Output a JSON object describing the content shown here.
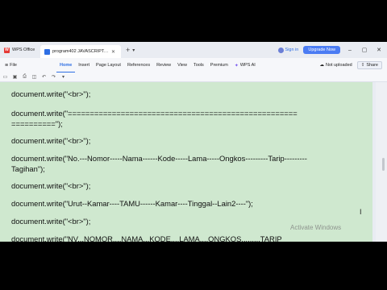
{
  "tabbar": {
    "wps_tab": "WPS Office",
    "doc_tab": "program402 JAVASCRIPT.dc",
    "signin": "Sign in",
    "upgrade": "Upgrade Now"
  },
  "menubar": {
    "file": "File",
    "items": [
      "Home",
      "Insert",
      "Page Layout",
      "References",
      "Review",
      "View",
      "Tools",
      "Premium",
      "WPS AI"
    ],
    "not_uploaded": "Not uploaded",
    "share": "Share"
  },
  "document": {
    "lines": [
      "document.write(\"<br>\");",
      "document.write(\"====================================================\n==========\");",
      "document.write(\"<br>\");",
      "document.write(\"No.---Nomor-----Nama------Kode-----Lama-----Ongkos---------Tarip---------Tagihan\");",
      "document.write(\"<br>\");",
      "document.write(\"Urut--Kamar----TAMU------Kamar----Tinggal--Lain2----\");",
      "document.write(\"<br>\");",
      "document.write(\"NV...NOMOR....NAMA...KODE....LAMA....ONGKOS.........TARIP"
    ]
  },
  "watermark": "Activate Windows",
  "colors": {
    "page_bg": "#cfe8cf",
    "accent": "#2f6fe4",
    "upgrade": "#4b7cf3"
  }
}
